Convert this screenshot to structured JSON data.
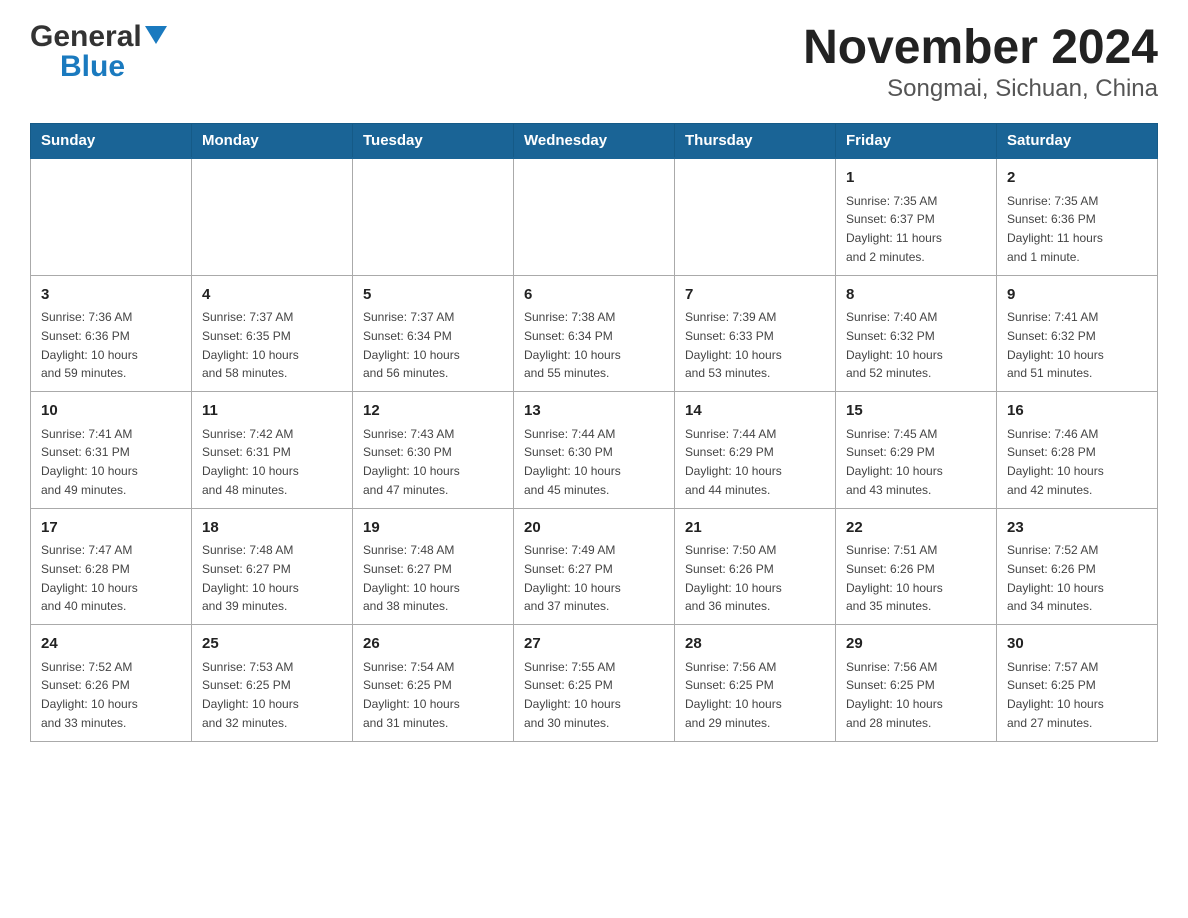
{
  "header": {
    "title": "November 2024",
    "subtitle": "Songmai, Sichuan, China"
  },
  "logo": {
    "general": "General",
    "blue": "Blue"
  },
  "days": {
    "headers": [
      "Sunday",
      "Monday",
      "Tuesday",
      "Wednesday",
      "Thursday",
      "Friday",
      "Saturday"
    ]
  },
  "weeks": [
    {
      "cells": [
        {
          "day": "",
          "info": ""
        },
        {
          "day": "",
          "info": ""
        },
        {
          "day": "",
          "info": ""
        },
        {
          "day": "",
          "info": ""
        },
        {
          "day": "",
          "info": ""
        },
        {
          "day": "1",
          "info": "Sunrise: 7:35 AM\nSunset: 6:37 PM\nDaylight: 11 hours\nand 2 minutes."
        },
        {
          "day": "2",
          "info": "Sunrise: 7:35 AM\nSunset: 6:36 PM\nDaylight: 11 hours\nand 1 minute."
        }
      ]
    },
    {
      "cells": [
        {
          "day": "3",
          "info": "Sunrise: 7:36 AM\nSunset: 6:36 PM\nDaylight: 10 hours\nand 59 minutes."
        },
        {
          "day": "4",
          "info": "Sunrise: 7:37 AM\nSunset: 6:35 PM\nDaylight: 10 hours\nand 58 minutes."
        },
        {
          "day": "5",
          "info": "Sunrise: 7:37 AM\nSunset: 6:34 PM\nDaylight: 10 hours\nand 56 minutes."
        },
        {
          "day": "6",
          "info": "Sunrise: 7:38 AM\nSunset: 6:34 PM\nDaylight: 10 hours\nand 55 minutes."
        },
        {
          "day": "7",
          "info": "Sunrise: 7:39 AM\nSunset: 6:33 PM\nDaylight: 10 hours\nand 53 minutes."
        },
        {
          "day": "8",
          "info": "Sunrise: 7:40 AM\nSunset: 6:32 PM\nDaylight: 10 hours\nand 52 minutes."
        },
        {
          "day": "9",
          "info": "Sunrise: 7:41 AM\nSunset: 6:32 PM\nDaylight: 10 hours\nand 51 minutes."
        }
      ]
    },
    {
      "cells": [
        {
          "day": "10",
          "info": "Sunrise: 7:41 AM\nSunset: 6:31 PM\nDaylight: 10 hours\nand 49 minutes."
        },
        {
          "day": "11",
          "info": "Sunrise: 7:42 AM\nSunset: 6:31 PM\nDaylight: 10 hours\nand 48 minutes."
        },
        {
          "day": "12",
          "info": "Sunrise: 7:43 AM\nSunset: 6:30 PM\nDaylight: 10 hours\nand 47 minutes."
        },
        {
          "day": "13",
          "info": "Sunrise: 7:44 AM\nSunset: 6:30 PM\nDaylight: 10 hours\nand 45 minutes."
        },
        {
          "day": "14",
          "info": "Sunrise: 7:44 AM\nSunset: 6:29 PM\nDaylight: 10 hours\nand 44 minutes."
        },
        {
          "day": "15",
          "info": "Sunrise: 7:45 AM\nSunset: 6:29 PM\nDaylight: 10 hours\nand 43 minutes."
        },
        {
          "day": "16",
          "info": "Sunrise: 7:46 AM\nSunset: 6:28 PM\nDaylight: 10 hours\nand 42 minutes."
        }
      ]
    },
    {
      "cells": [
        {
          "day": "17",
          "info": "Sunrise: 7:47 AM\nSunset: 6:28 PM\nDaylight: 10 hours\nand 40 minutes."
        },
        {
          "day": "18",
          "info": "Sunrise: 7:48 AM\nSunset: 6:27 PM\nDaylight: 10 hours\nand 39 minutes."
        },
        {
          "day": "19",
          "info": "Sunrise: 7:48 AM\nSunset: 6:27 PM\nDaylight: 10 hours\nand 38 minutes."
        },
        {
          "day": "20",
          "info": "Sunrise: 7:49 AM\nSunset: 6:27 PM\nDaylight: 10 hours\nand 37 minutes."
        },
        {
          "day": "21",
          "info": "Sunrise: 7:50 AM\nSunset: 6:26 PM\nDaylight: 10 hours\nand 36 minutes."
        },
        {
          "day": "22",
          "info": "Sunrise: 7:51 AM\nSunset: 6:26 PM\nDaylight: 10 hours\nand 35 minutes."
        },
        {
          "day": "23",
          "info": "Sunrise: 7:52 AM\nSunset: 6:26 PM\nDaylight: 10 hours\nand 34 minutes."
        }
      ]
    },
    {
      "cells": [
        {
          "day": "24",
          "info": "Sunrise: 7:52 AM\nSunset: 6:26 PM\nDaylight: 10 hours\nand 33 minutes."
        },
        {
          "day": "25",
          "info": "Sunrise: 7:53 AM\nSunset: 6:25 PM\nDaylight: 10 hours\nand 32 minutes."
        },
        {
          "day": "26",
          "info": "Sunrise: 7:54 AM\nSunset: 6:25 PM\nDaylight: 10 hours\nand 31 minutes."
        },
        {
          "day": "27",
          "info": "Sunrise: 7:55 AM\nSunset: 6:25 PM\nDaylight: 10 hours\nand 30 minutes."
        },
        {
          "day": "28",
          "info": "Sunrise: 7:56 AM\nSunset: 6:25 PM\nDaylight: 10 hours\nand 29 minutes."
        },
        {
          "day": "29",
          "info": "Sunrise: 7:56 AM\nSunset: 6:25 PM\nDaylight: 10 hours\nand 28 minutes."
        },
        {
          "day": "30",
          "info": "Sunrise: 7:57 AM\nSunset: 6:25 PM\nDaylight: 10 hours\nand 27 minutes."
        }
      ]
    }
  ]
}
